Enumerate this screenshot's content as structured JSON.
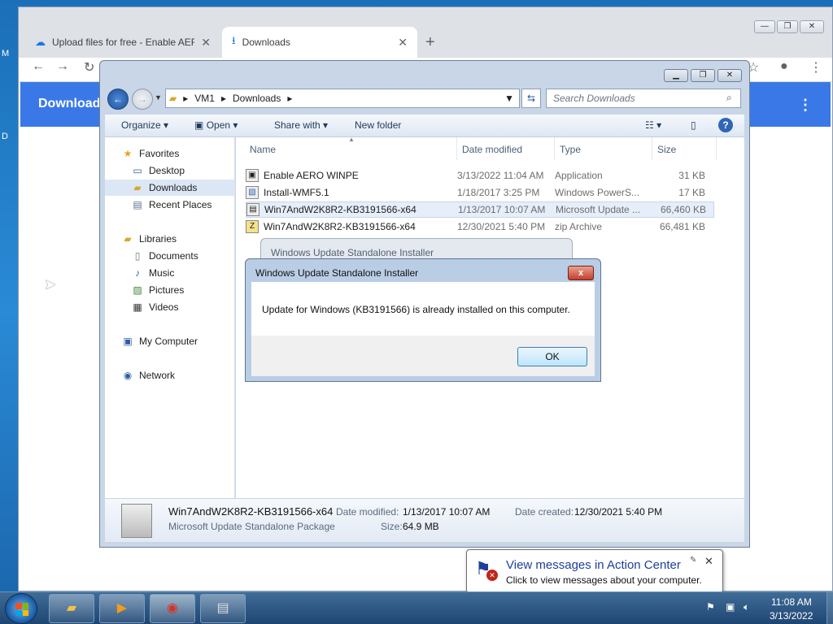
{
  "desktop": {
    "left_glyph_1": "M",
    "left_glyph_2": "D"
  },
  "chrome": {
    "tabs": [
      {
        "title": "Upload files for free - Enable AER",
        "icon": "cloud-upload-icon"
      },
      {
        "title": "Downloads",
        "icon": "download-icon"
      }
    ],
    "new_tab": "+",
    "page_heading": "Download",
    "kebab": "⋮"
  },
  "explorer": {
    "breadcrumb": [
      "VM1",
      "Downloads"
    ],
    "search_placeholder": "Search Downloads",
    "toolbar": {
      "organize": "Organize",
      "open": "Open",
      "share_with": "Share with",
      "new_folder": "New folder"
    },
    "nav": {
      "favorites": "Favorites",
      "favorites_items": [
        "Desktop",
        "Downloads",
        "Recent Places"
      ],
      "libraries": "Libraries",
      "libraries_items": [
        "Documents",
        "Music",
        "Pictures",
        "Videos"
      ],
      "computer": "My Computer",
      "network": "Network"
    },
    "columns": {
      "name": "Name",
      "date": "Date modified",
      "type": "Type",
      "size": "Size"
    },
    "files": [
      {
        "name": "Enable AERO WINPE",
        "date": "3/13/2022 11:04 AM",
        "type": "Application",
        "size": "31 KB"
      },
      {
        "name": "Install-WMF5.1",
        "date": "1/18/2017 3:25 PM",
        "type": "Windows PowerS...",
        "size": "17 KB"
      },
      {
        "name": "Win7AndW2K8R2-KB3191566-x64",
        "date": "1/13/2017 10:07 AM",
        "type": "Microsoft Update ...",
        "size": "66,460 KB"
      },
      {
        "name": "Win7AndW2K8R2-KB3191566-x64",
        "date": "12/30/2021 5:40 PM",
        "type": "zip Archive",
        "size": "66,481 KB"
      }
    ],
    "details": {
      "name": "Win7AndW2K8R2-KB3191566-x64",
      "kind": "Microsoft Update Standalone Package",
      "modified_label": "Date modified:",
      "modified_value": "1/13/2017 10:07 AM",
      "created_label": "Date created:",
      "created_value": "12/30/2021 5:40 PM",
      "size_label": "Size:",
      "size_value": "64.9 MB"
    }
  },
  "bg_dialog": {
    "title": "Windows Update Standalone Installer"
  },
  "dialog": {
    "title": "Windows Update Standalone Installer",
    "message": "Update for Windows (KB3191566) is already installed on this computer.",
    "ok": "OK",
    "close": "x"
  },
  "notification": {
    "title": "View messages in Action Center",
    "text": "Click to view messages about your computer."
  },
  "taskbar": {
    "time": "11:08 AM",
    "date": "3/13/2022"
  }
}
